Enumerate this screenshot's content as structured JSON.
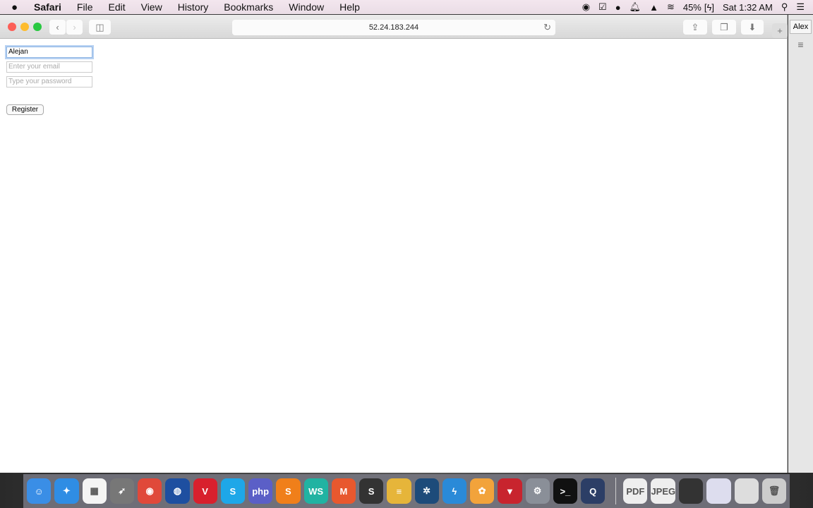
{
  "menubar": {
    "app": "Safari",
    "items": [
      "File",
      "Edit",
      "View",
      "History",
      "Bookmarks",
      "Window",
      "Help"
    ],
    "battery": "45%",
    "clock": "Sat 1:32 AM"
  },
  "browser": {
    "url": "52.24.183.244",
    "profile": "Alex"
  },
  "form": {
    "name_value": "Alejan",
    "email_placeholder": "Enter your email",
    "password_placeholder": "Type your password",
    "register_label": "Register"
  },
  "dock": {
    "apps": [
      {
        "name": "finder",
        "color": "#3a8ee6",
        "glyph": "☺"
      },
      {
        "name": "safari",
        "color": "#2f8de4",
        "glyph": "✦"
      },
      {
        "name": "launchpad",
        "color": "#f4f4f4",
        "glyph": "▦"
      },
      {
        "name": "rocket",
        "color": "#777",
        "glyph": "➶"
      },
      {
        "name": "chrome",
        "color": "#e0493a",
        "glyph": "◉"
      },
      {
        "name": "firefox",
        "color": "#1e4fa0",
        "glyph": "◍"
      },
      {
        "name": "vivaldi",
        "color": "#d8202d",
        "glyph": "V"
      },
      {
        "name": "skype",
        "color": "#1ea7e8",
        "glyph": "S"
      },
      {
        "name": "phpstorm",
        "color": "#5b5fc7",
        "glyph": "php"
      },
      {
        "name": "sublime",
        "color": "#f07f1a",
        "glyph": "S"
      },
      {
        "name": "webstorm",
        "color": "#21b3a2",
        "glyph": "WS"
      },
      {
        "name": "meteor",
        "color": "#e8582e",
        "glyph": "M"
      },
      {
        "name": "sublime-text",
        "color": "#333",
        "glyph": "S"
      },
      {
        "name": "sequel",
        "color": "#e6b53a",
        "glyph": "≡"
      },
      {
        "name": "sourcetree",
        "color": "#1d4b7a",
        "glyph": "✲"
      },
      {
        "name": "reeder",
        "color": "#2a8ad8",
        "glyph": "ϟ"
      },
      {
        "name": "photos",
        "color": "#f2a33b",
        "glyph": "✿"
      },
      {
        "name": "popcorn",
        "color": "#c8242e",
        "glyph": "▼"
      },
      {
        "name": "system-preferences",
        "color": "#8a8f98",
        "glyph": "⚙"
      },
      {
        "name": "terminal",
        "color": "#111",
        "glyph": ">_"
      },
      {
        "name": "quicktime",
        "color": "#2c3e66",
        "glyph": "Q"
      }
    ],
    "docs": [
      {
        "name": "pdf-document",
        "color": "#eee",
        "glyph": "PDF"
      },
      {
        "name": "jpeg-document",
        "color": "#eee",
        "glyph": "JPEG"
      },
      {
        "name": "screenshot-1",
        "color": "#333",
        "glyph": ""
      },
      {
        "name": "screenshot-2",
        "color": "#dde",
        "glyph": ""
      },
      {
        "name": "screenshot-3",
        "color": "#ddd",
        "glyph": ""
      },
      {
        "name": "trash",
        "color": "#ccc",
        "glyph": "🗑"
      }
    ]
  }
}
